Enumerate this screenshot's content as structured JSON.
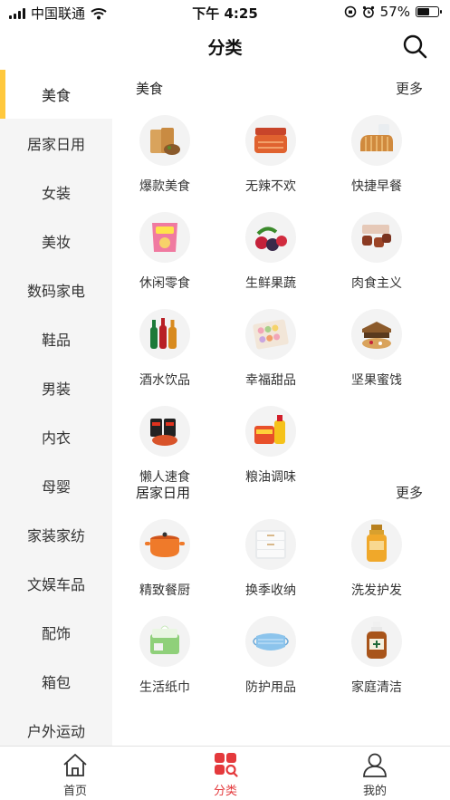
{
  "status_bar": {
    "carrier": "中国联通",
    "time": "下午 4:25",
    "battery": "57%",
    "battery_level": 0.57
  },
  "header": {
    "title": "分类"
  },
  "sidebar": {
    "items": [
      {
        "label": "美食"
      },
      {
        "label": "居家日用"
      },
      {
        "label": "女装"
      },
      {
        "label": "美妆"
      },
      {
        "label": "数码家电"
      },
      {
        "label": "鞋品"
      },
      {
        "label": "男装"
      },
      {
        "label": "内衣"
      },
      {
        "label": "母婴"
      },
      {
        "label": "家装家纺"
      },
      {
        "label": "文娱车品"
      },
      {
        "label": "配饰"
      },
      {
        "label": "箱包"
      },
      {
        "label": "户外运动"
      }
    ]
  },
  "sections": [
    {
      "title": "美食",
      "more": "更多",
      "items": [
        {
          "label": "爆款美食",
          "icon": "snack-pack-icon"
        },
        {
          "label": "无辣不欢",
          "icon": "spicy-meat-icon"
        },
        {
          "label": "快捷早餐",
          "icon": "bread-icon"
        },
        {
          "label": "休闲零食",
          "icon": "chips-bag-icon"
        },
        {
          "label": "生鲜果蔬",
          "icon": "fruit-icon"
        },
        {
          "label": "肉食主义",
          "icon": "meat-cubes-icon"
        },
        {
          "label": "酒水饮品",
          "icon": "bottles-icon"
        },
        {
          "label": "幸福甜品",
          "icon": "macaron-box-icon"
        },
        {
          "label": "坚果蜜饯",
          "icon": "nut-box-icon"
        },
        {
          "label": "懒人速食",
          "icon": "instant-noodle-icon"
        },
        {
          "label": "粮油调味",
          "icon": "oil-rice-icon"
        }
      ]
    },
    {
      "title": "居家日用",
      "more": "更多",
      "items": [
        {
          "label": "精致餐厨",
          "icon": "cooking-pot-icon"
        },
        {
          "label": "换季收纳",
          "icon": "storage-drawer-icon"
        },
        {
          "label": "洗发护发",
          "icon": "shampoo-bottle-icon"
        },
        {
          "label": "生活纸巾",
          "icon": "tissue-pack-icon"
        },
        {
          "label": "防护用品",
          "icon": "face-mask-icon"
        },
        {
          "label": "家庭清洁",
          "icon": "disinfectant-bottle-icon"
        }
      ]
    }
  ],
  "tabbar": {
    "tabs": [
      {
        "label": "首页",
        "icon": "home-icon"
      },
      {
        "label": "分类",
        "icon": "category-icon",
        "active": true
      },
      {
        "label": "我的",
        "icon": "profile-icon"
      }
    ]
  }
}
